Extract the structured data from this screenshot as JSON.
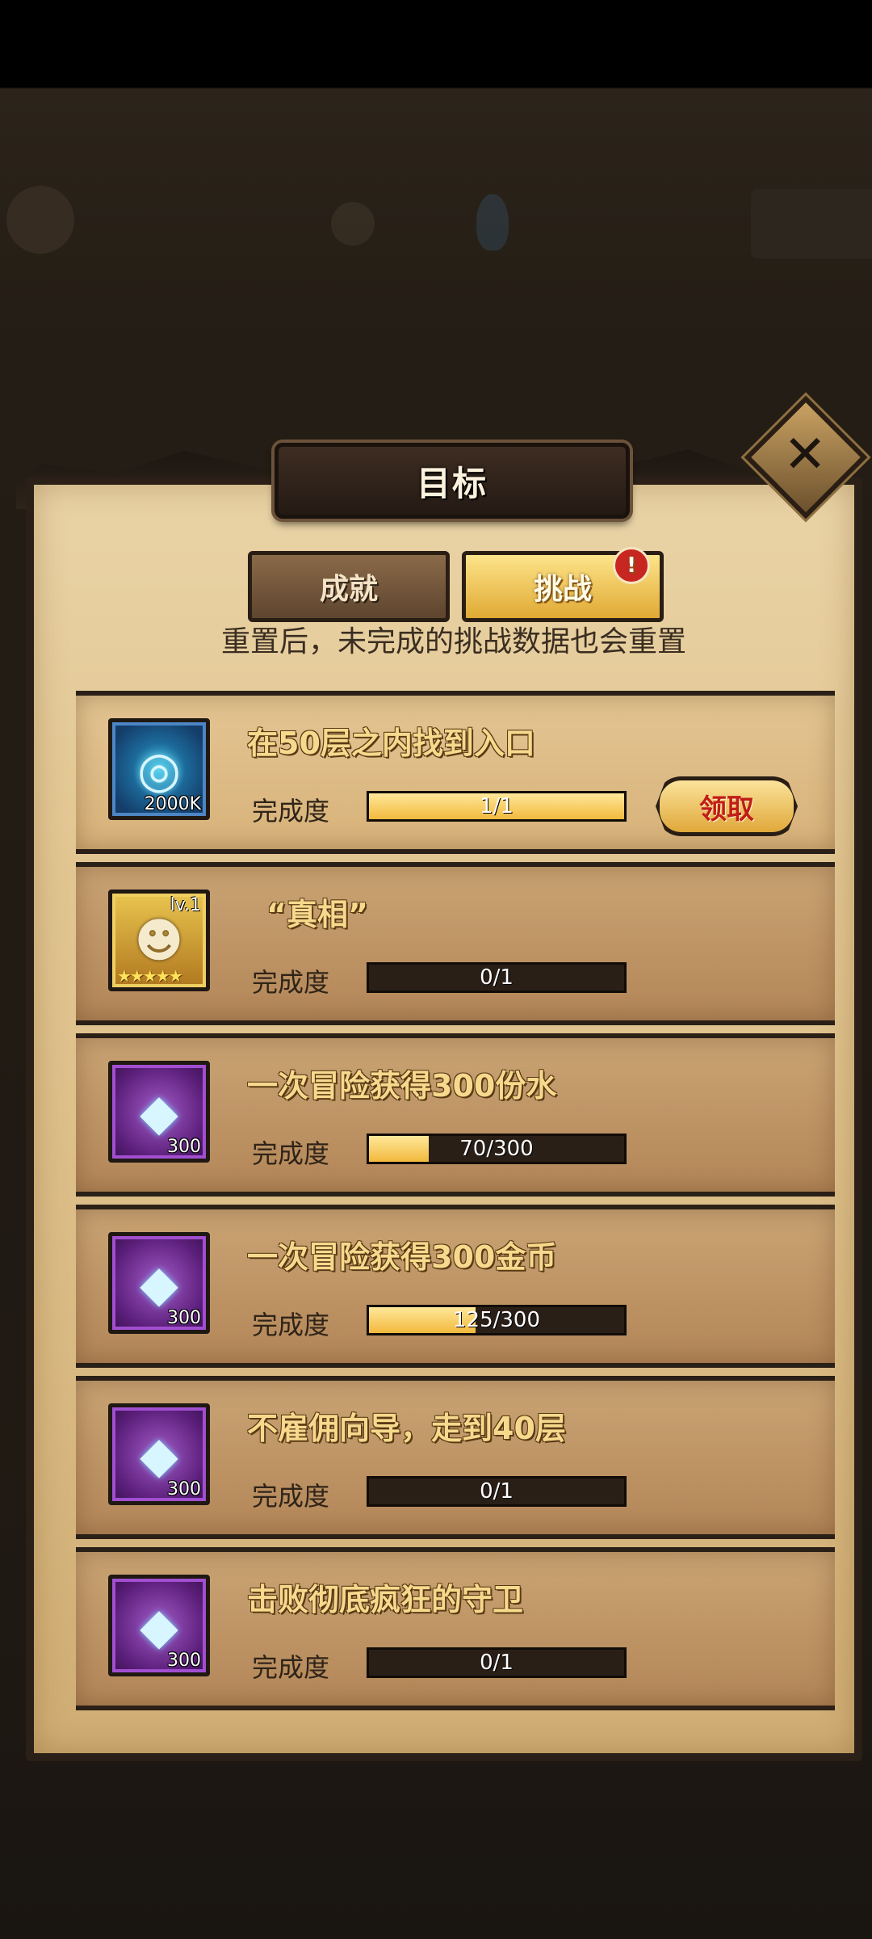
{
  "modal": {
    "title": "目标",
    "tabs": [
      {
        "label": "成就"
      },
      {
        "label": "挑战",
        "badge": "!"
      }
    ],
    "subtitle": "重置后，未完成的挑战数据也会重置",
    "progress_label": "完成度",
    "claim_label": "领取"
  },
  "challenges": [
    {
      "title": "在50层之内找到入口",
      "icon": "blue-orb-icon",
      "qty": "2000K",
      "progress": "1/1",
      "fraction": 1.0,
      "claimable": true
    },
    {
      "title": "“真相”",
      "icon": "hero-portrait-icon",
      "level": "lv.1",
      "stars": "★★★★★",
      "progress": "0/1",
      "fraction": 0.0
    },
    {
      "title": "一次冒险获得300份水",
      "icon": "diamond-icon",
      "qty": "300",
      "progress": "70/300",
      "fraction": 0.233
    },
    {
      "title": "一次冒险获得300金币",
      "icon": "diamond-icon",
      "qty": "300",
      "progress": "125/300",
      "fraction": 0.417
    },
    {
      "title": "不雇佣向导，走到40层",
      "icon": "diamond-icon",
      "qty": "300",
      "progress": "0/1",
      "fraction": 0.0
    },
    {
      "title": "击败彻底疯狂的守卫",
      "icon": "diamond-icon",
      "qty": "300",
      "progress": "0/1",
      "fraction": 0.0
    }
  ]
}
